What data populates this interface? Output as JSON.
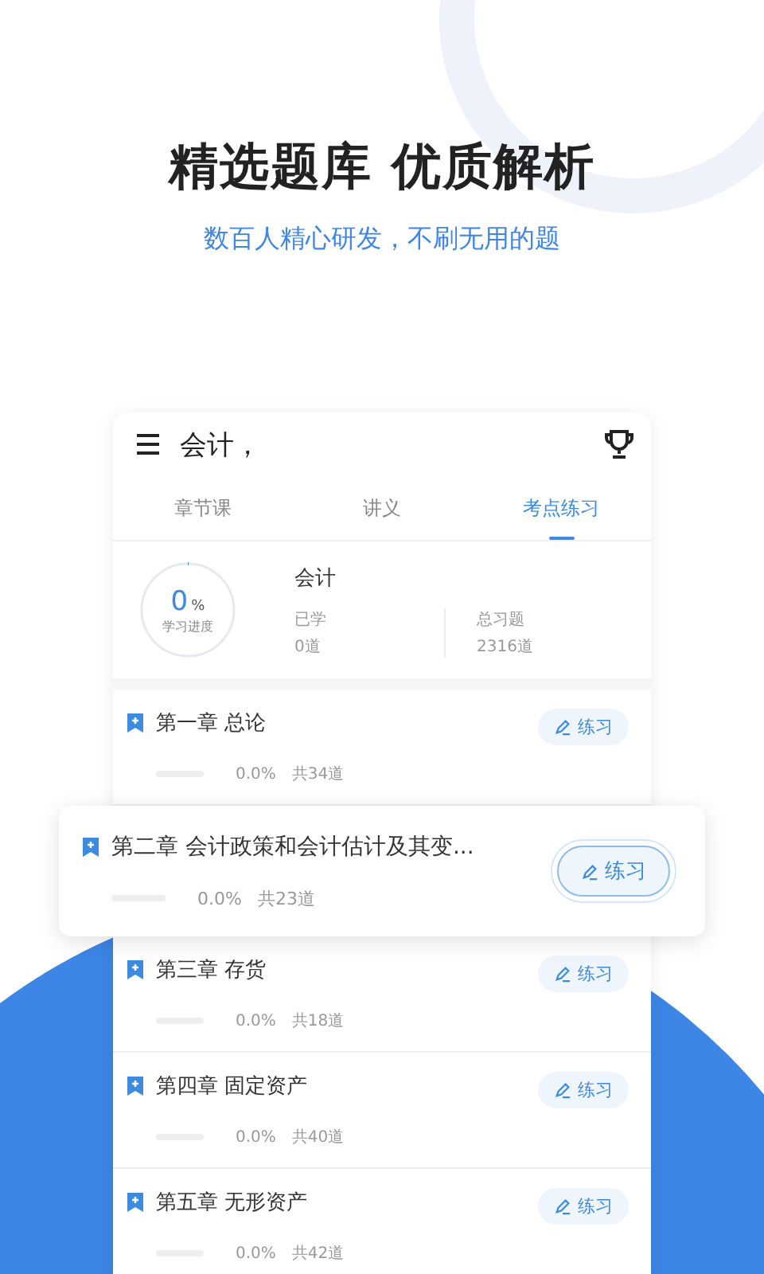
{
  "headline": "精选题库 优质解析",
  "subtitle": "数百人精心研发，不刷无用的题",
  "app_bar": {
    "title": "会计，"
  },
  "tabs": [
    {
      "label": "章节课",
      "selected": false
    },
    {
      "label": "讲义",
      "selected": false
    },
    {
      "label": "考点练习",
      "selected": true
    }
  ],
  "summary": {
    "progress_value": "0",
    "progress_unit": "%",
    "progress_label": "学习进度",
    "level": 0,
    "subject": "会计",
    "learned_label": "已学",
    "learned_value": "0道",
    "total_label": "总习题",
    "total_value": "2316道"
  },
  "chapters": [
    {
      "kind": "normal",
      "title": "第一章 总论",
      "level": 0,
      "percent": "0.0%",
      "count": "共34道",
      "button": "练习"
    },
    {
      "kind": "highlighted",
      "title": "第二章 会计政策和会计估计及其变...",
      "level": 0,
      "percent": "0.0%",
      "count": "共23道",
      "button": "练习"
    },
    {
      "kind": "normal",
      "title": "第三章 存货",
      "level": 0,
      "percent": "0.0%",
      "count": "共18道",
      "button": "练习"
    },
    {
      "kind": "normal",
      "title": "第四章 固定资产",
      "level": 0,
      "percent": "0.0%",
      "count": "共40道",
      "button": "练习"
    },
    {
      "kind": "normal",
      "title": "第五章 无形资产",
      "level": 0,
      "percent": "0.0%",
      "count": "共42道",
      "button": "练习"
    }
  ]
}
